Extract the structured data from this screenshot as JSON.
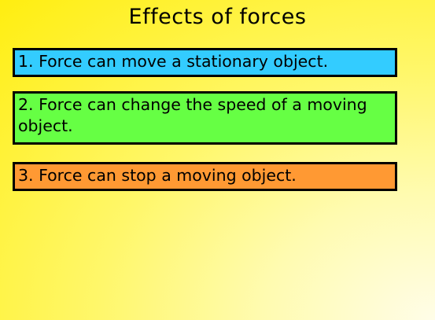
{
  "slide": {
    "title": "Effects of forces",
    "points": [
      {
        "text": "1. Force can move a stationary object.",
        "color": "#33ccff"
      },
      {
        "text": "2. Force can change the speed of a moving object.",
        "color": "#66ff44"
      },
      {
        "text": "3. Force can stop a moving object.",
        "color": "#ff9933"
      }
    ]
  }
}
